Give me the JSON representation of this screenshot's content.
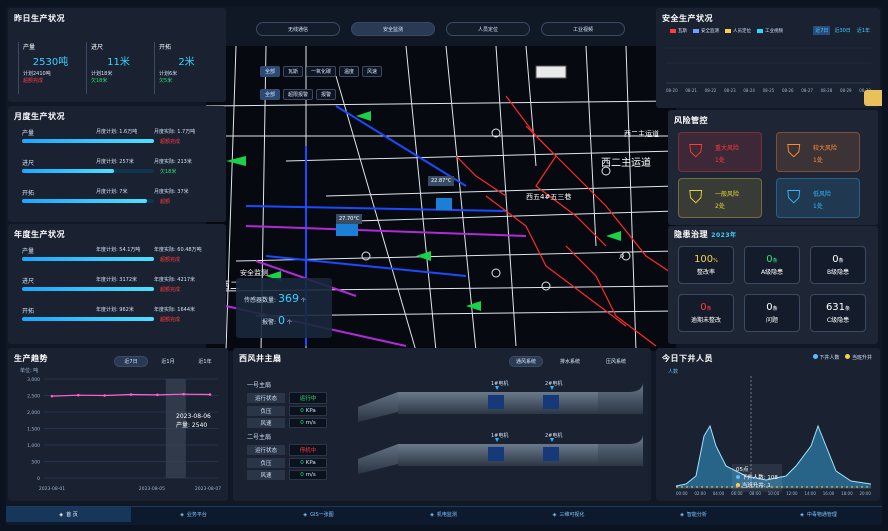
{
  "yesterday": {
    "title": "昨日生产状况",
    "items": [
      {
        "label": "产量",
        "value": "2530吨",
        "plan": "计划2410吨",
        "status": "超额完成"
      },
      {
        "label": "进尺",
        "value": "11米",
        "plan": "计划18米",
        "status": "欠18米"
      },
      {
        "label": "开拓",
        "value": "2米",
        "plan": "计划6米",
        "status": "欠5米"
      }
    ]
  },
  "monthly": {
    "title": "月度生产状况",
    "rows": [
      {
        "label": "产量",
        "plan": "月度计划: 1.6万吨",
        "actual": "月度实际: 1.7万吨",
        "status": "超额完成",
        "progress": 1.0
      },
      {
        "label": "进尺",
        "plan": "月度计划: 257米",
        "actual": "月度实际: 213米",
        "status": "欠18米",
        "progress": 0.7
      },
      {
        "label": "开拓",
        "plan": "月度计划: 7米",
        "actual": "月度实际: 37米",
        "status": "超额",
        "progress": 0.95
      }
    ]
  },
  "annual": {
    "title": "年度生产状况",
    "rows": [
      {
        "label": "产量",
        "plan": "年度计划: 54.1万吨",
        "actual": "年度实际: 60.48万吨",
        "status": "超额完成",
        "progress": 1.0
      },
      {
        "label": "进尺",
        "plan": "年度计划: 3172米",
        "actual": "年度实际: 4217米",
        "status": "超额完成",
        "progress": 1.0
      },
      {
        "label": "开拓",
        "plan": "年度计划: 962米",
        "actual": "年度实际: 1644米",
        "status": "超额完成",
        "progress": 1.0
      }
    ]
  },
  "top_tabs": [
    "无线通信",
    "安全监测",
    "人员定位",
    "工业视频"
  ],
  "map": {
    "filters_row1": [
      "全部",
      "瓦斯",
      "一氧化碳",
      "温度",
      "风速"
    ],
    "filters_row2": [
      "全部",
      "超限报警",
      "报警"
    ],
    "labels": [
      "西二主运道",
      "西五4#五三巷",
      "西二主运道"
    ],
    "temp1": "22.87°C",
    "temp2": "27.70°C",
    "overlay_title": "安全监测",
    "sensor_label": "传感器数量:",
    "sensor_value": "369",
    "sensor_unit": "个",
    "alarm_label": "报警:",
    "alarm_value": "0",
    "alarm_unit": "个"
  },
  "safety": {
    "title": "安全生产状况",
    "legend": [
      "瓦斯",
      "安全监测",
      "人员定位",
      "工业视频"
    ],
    "legend_colors": [
      "#ff3b3b",
      "#6aa2ff",
      "#f7d04a",
      "#2fd8ff"
    ],
    "periods": [
      "近7日",
      "近30日",
      "近1年"
    ],
    "xticks": [
      "08-20",
      "08-21",
      "08-22",
      "08-23",
      "08-24",
      "08-25",
      "08-26",
      "08-27",
      "08-28",
      "08-29",
      "08-30"
    ]
  },
  "risk": {
    "title": "风险管控",
    "cards": [
      {
        "name": "重大风险",
        "count": "1处",
        "color": "#ff3b3b"
      },
      {
        "name": "较大风险",
        "count": "1处",
        "color": "#ff8c3a"
      },
      {
        "name": "一般风险",
        "count": "2处",
        "color": "#e8d23a"
      },
      {
        "name": "低风险",
        "count": "1处",
        "color": "#2fb8ff"
      }
    ]
  },
  "hazard": {
    "title": "隐患治理",
    "year": "2023年",
    "cells": [
      {
        "value": "100",
        "unit": "%",
        "label": "整改率",
        "color": "#f7d04a"
      },
      {
        "value": "0",
        "unit": "条",
        "label": "A级隐患",
        "color": "#2fe07a"
      },
      {
        "value": "0",
        "unit": "条",
        "label": "B级隐患",
        "color": "#ffffff"
      },
      {
        "value": "0",
        "unit": "条",
        "label": "逾期未整改",
        "color": "#ff3b3b"
      },
      {
        "value": "0",
        "unit": "条",
        "label": "问题",
        "color": "#ffffff"
      },
      {
        "value": "631",
        "unit": "条",
        "label": "C级隐患",
        "color": "#ffffff"
      }
    ]
  },
  "trend": {
    "title": "生产趋势",
    "tabs": [
      "近7日",
      "近1月",
      "近1年"
    ],
    "unit": "单位: 吨",
    "tooltip_date": "2023-08-06",
    "tooltip_value": "产量: 2540",
    "chart_data": {
      "type": "line",
      "yticks": [
        "3,000",
        "2,500",
        "2,000",
        "1,500",
        "1,000",
        "500",
        "0"
      ],
      "xticks": [
        "2023-08-01",
        "2023-08-05",
        "2023-08-07"
      ],
      "ylim": [
        0,
        3000
      ],
      "values": [
        2480,
        2510,
        2500,
        2530,
        2520,
        2540,
        2530
      ]
    }
  },
  "fan": {
    "title": "西风井主扇",
    "tabs": [
      "通风系统",
      "排水系统",
      "压风系统"
    ],
    "group1": {
      "title": "一号主扇",
      "rows": [
        {
          "k": "运行状态",
          "v": "运行中"
        },
        {
          "k": "负压",
          "v": "0",
          "u": "KPa"
        },
        {
          "k": "风速",
          "v": "0",
          "u": "m/s"
        }
      ]
    },
    "group2": {
      "title": "二号主扇",
      "rows": [
        {
          "k": "运行状态",
          "v": "停机中"
        },
        {
          "k": "负压",
          "v": "0",
          "u": "KPa"
        },
        {
          "k": "风速",
          "v": "0",
          "u": "m/s"
        }
      ]
    },
    "motors": [
      "1#电机",
      "2#电机",
      "1#电机",
      "2#电机"
    ]
  },
  "people": {
    "title": "今日下井人员",
    "unit": "人数",
    "legend": [
      "下井人数",
      "当班升井"
    ],
    "tooltip_time": "05点",
    "tooltip_l1": "下井人数: 108",
    "tooltip_l2": "当班升井: 1",
    "xticks": [
      "00:00",
      "02:00",
      "04:00",
      "06:00",
      "08:00",
      "10:00",
      "12:00",
      "14:00",
      "16:00",
      "18:00",
      "20:00"
    ]
  },
  "nav": [
    "首 页",
    "业务平台",
    "GIS一张图",
    "机电监测",
    "三维可视化",
    "智能分析",
    "中毒物通管理"
  ]
}
